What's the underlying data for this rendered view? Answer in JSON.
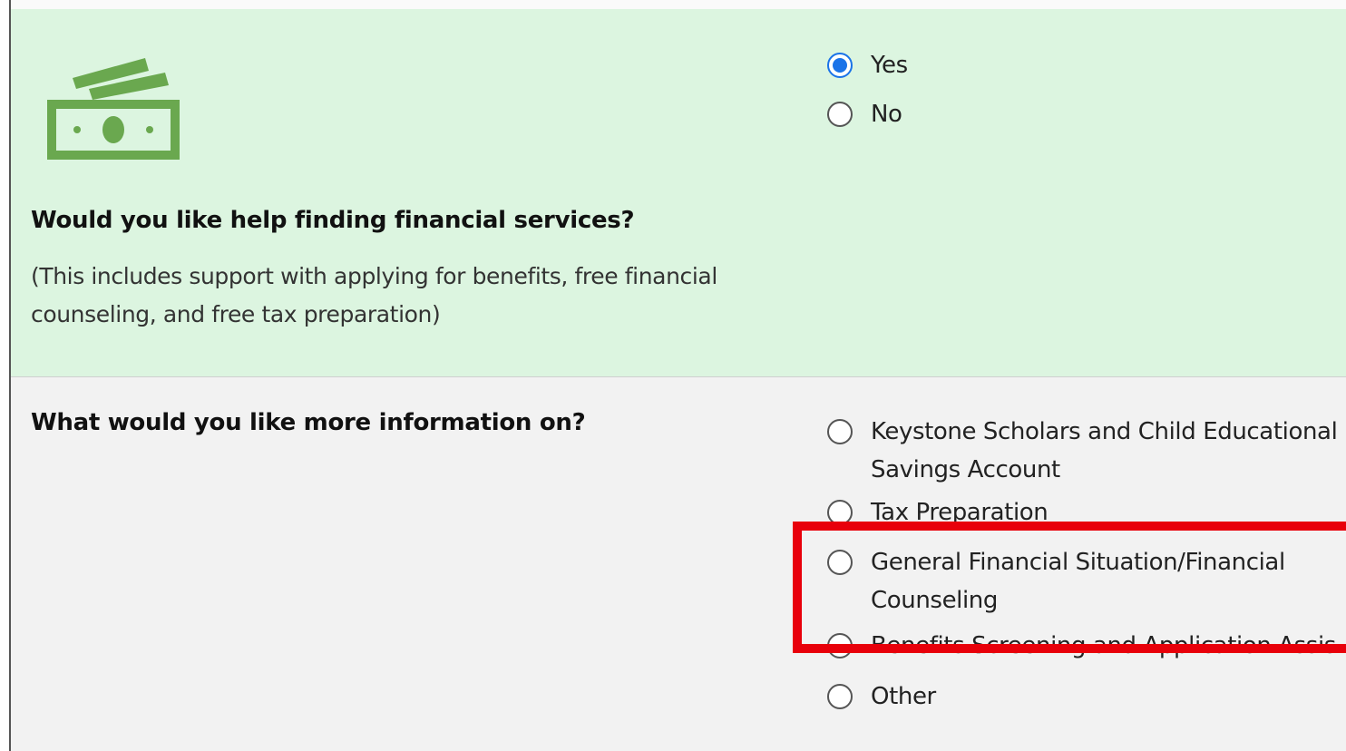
{
  "q1": {
    "title": "Would you like help finding financial services?",
    "subtitle_line1": "(This includes support with applying for benefits, free financial",
    "subtitle_line2": "counseling, and free tax preparation)",
    "icon": "money-icon",
    "options": [
      {
        "label": "Yes",
        "selected": true
      },
      {
        "label": "No",
        "selected": false
      }
    ]
  },
  "q2": {
    "title": "What would you like more information on?",
    "options": [
      {
        "line1": "Keystone Scholars and Child Educational",
        "line2": "Savings Account",
        "selected": false
      },
      {
        "line1": "Tax Preparation",
        "selected": false
      },
      {
        "line1": "General Financial Situation/Financial",
        "line2": "Counseling",
        "selected": false
      },
      {
        "line1": "Benefits Screening and Application Assis",
        "selected": false
      },
      {
        "line1": "Other",
        "selected": false
      }
    ]
  },
  "colors": {
    "q1_bg": "#dcf5e0",
    "q2_bg": "#f2f2f2",
    "radio_selected": "#1a73e8",
    "icon_green": "#6aa84f",
    "highlight": "#e8000b"
  }
}
